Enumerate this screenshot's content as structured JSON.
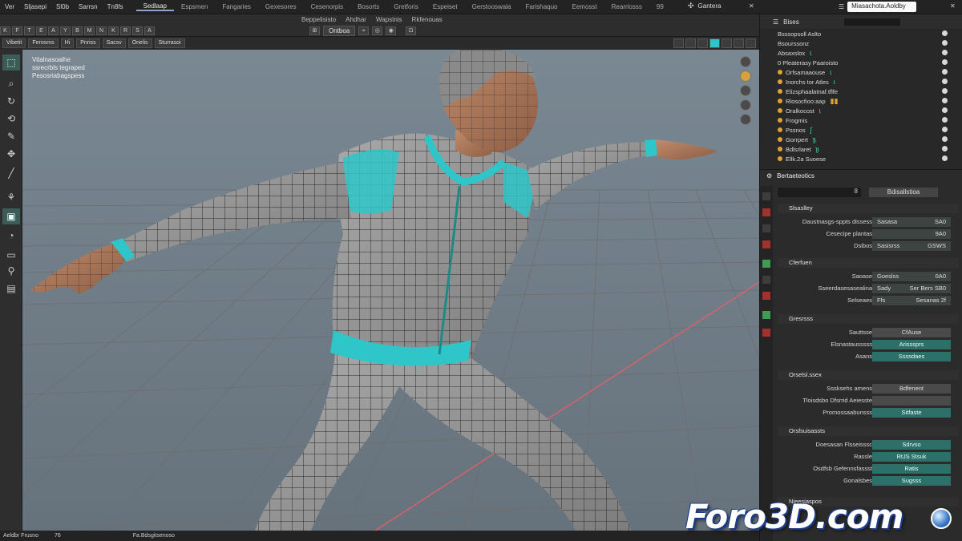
{
  "menu": {
    "items": [
      "Ver",
      "Sljasepi",
      "Sl0b",
      "Sarrsn",
      "Tn8fs"
    ],
    "workspaces": [
      "Sedlaap",
      "Espsmen",
      "Fangaries",
      "Gexesores",
      "Cesenorpis",
      "Bosorts",
      "Gretforis",
      "Espeiset",
      "Gerstooswala",
      "Farishaquo",
      "Eemosst",
      "Rearriosss",
      "99"
    ],
    "active_workspace": "Sedlaap",
    "scene_label": "Gantera",
    "search_value": "Miasachota.Aoldby"
  },
  "header2": {
    "tabs": [
      "Beppelisisto",
      "Ahdhar",
      "Wapstnis",
      "Rkfenouas"
    ],
    "mode_buttons": [
      "K",
      "F",
      "T",
      "E",
      "A",
      "Y",
      "B",
      "M",
      "N",
      "K",
      "R",
      "S",
      "A"
    ],
    "dropdown": "Ontboa"
  },
  "viewport_header": {
    "buttons": [
      "Vibetit",
      "Ferosms",
      "Hi",
      "Pnriss",
      "Sacsv",
      "Onelis",
      "Sturrasoi"
    ]
  },
  "viewport": {
    "info_lines": [
      "Vitalnasoalhe",
      "ssrecrbls tegraped",
      "Pesosriabagspess"
    ]
  },
  "status": {
    "left": "Aeldbr Frusno",
    "count": "76",
    "right": "Fa.Bdsgitsenoso"
  },
  "outliner": {
    "title": "Bises",
    "rows": [
      {
        "label": "Bsssopsoll Aslto",
        "accent": ""
      },
      {
        "label": "Bsourssonz",
        "accent": ""
      },
      {
        "label": "Absaxslox",
        "accent": "ɩ"
      },
      {
        "label": "0 Pleaterasy Paaroisto",
        "accent": ""
      },
      {
        "label": "Orfsamaaouse",
        "accent": "ɩ"
      },
      {
        "label": "Inorchs tor Atles",
        "accent": "ɩ"
      },
      {
        "label": "Elizsphaalatnaf.tflfe",
        "accent": ""
      },
      {
        "label": "Rlosocfioo:aap",
        "accent": "▮▮"
      },
      {
        "label": "Oralkocost",
        "accent": "ɩ"
      },
      {
        "label": "Frogmis",
        "accent": ""
      },
      {
        "label": "Pssnos",
        "accent": "ʃ"
      },
      {
        "label": "Gorrpert",
        "accent": "ʅɩ"
      },
      {
        "label": "Bdlsrlaret",
        "accent": "ʅɩ"
      },
      {
        "label": "Ellk.2a Suoese",
        "accent": ""
      }
    ]
  },
  "properties": {
    "title": "Bertaeteotics",
    "search_value": "8",
    "button": "Bdisallstioa",
    "sections": [
      {
        "title": "Slsaslley",
        "fields": [
          {
            "label": "Daustnasgs-sppts dissess",
            "value": "Sasasa",
            "value2": "SA0",
            "style": "plain"
          },
          {
            "label": "Cesecipe plantas",
            "value": "",
            "value2": "9A0",
            "style": "plain"
          },
          {
            "label": "Dsibos",
            "value": "Sasisrss",
            "value2": "GSWS",
            "style": "plain"
          }
        ]
      },
      {
        "title": "Cferfuen",
        "fields": [
          {
            "label": "Saoase",
            "value": "Goeslss",
            "value2": "0A0",
            "style": "plain"
          },
          {
            "label": "Sseerdasesasealina",
            "value": "Sady",
            "value2": "Ser Bers  SB0",
            "style": "plain"
          },
          {
            "label": "Selseaes",
            "value": "Ffs",
            "value2": "Sesanas  2f",
            "style": "plain"
          }
        ]
      },
      {
        "title": "Gresrsss",
        "fields": [
          {
            "label": "Sauttsse",
            "value": "CfAuse",
            "value2": "",
            "style": "grey"
          },
          {
            "label": "Elsnastausssss",
            "value": "Arisssprs",
            "value2": "",
            "style": "teal"
          },
          {
            "label": "Asans",
            "value": "Ssssdaes",
            "value2": "",
            "style": "teal"
          }
        ]
      },
      {
        "title": "Orselsl.ssex",
        "fields": [
          {
            "label": "Sssksehs amens",
            "value": "Bdfenent",
            "value2": "",
            "style": "grey"
          },
          {
            "label": "Tloisdsbo Dfsrrid Aeiesste",
            "value": "",
            "value2": "",
            "style": "grey"
          },
          {
            "label": "Promossaabunsss",
            "value": "Sitfaste",
            "value2": "",
            "style": "teal"
          }
        ]
      },
      {
        "title": "Orsfsuisassts",
        "fields": [
          {
            "label": "Doesasan Flsseisssc",
            "value": "Sdrvso",
            "value2": "",
            "style": "teal"
          },
          {
            "label": "Rassle",
            "value": "RtJS Stsuk",
            "value2": "",
            "style": "teal"
          },
          {
            "label": "Osdfsb Gefennsfassst",
            "value": "Ratis",
            "value2": "",
            "style": "teal"
          },
          {
            "label": "Gonalsbes",
            "value": "Sugsss",
            "value2": "",
            "style": "teal"
          }
        ]
      },
      {
        "title": "Nieesiaspos",
        "fields": []
      }
    ]
  },
  "watermark": "Foro3D.com",
  "colors": {
    "accent_teal": "#2ec6c9",
    "viewport_bg": "#707d88",
    "panel_bg": "#2b2b2b",
    "grid_x_axis": "#d9626a"
  }
}
